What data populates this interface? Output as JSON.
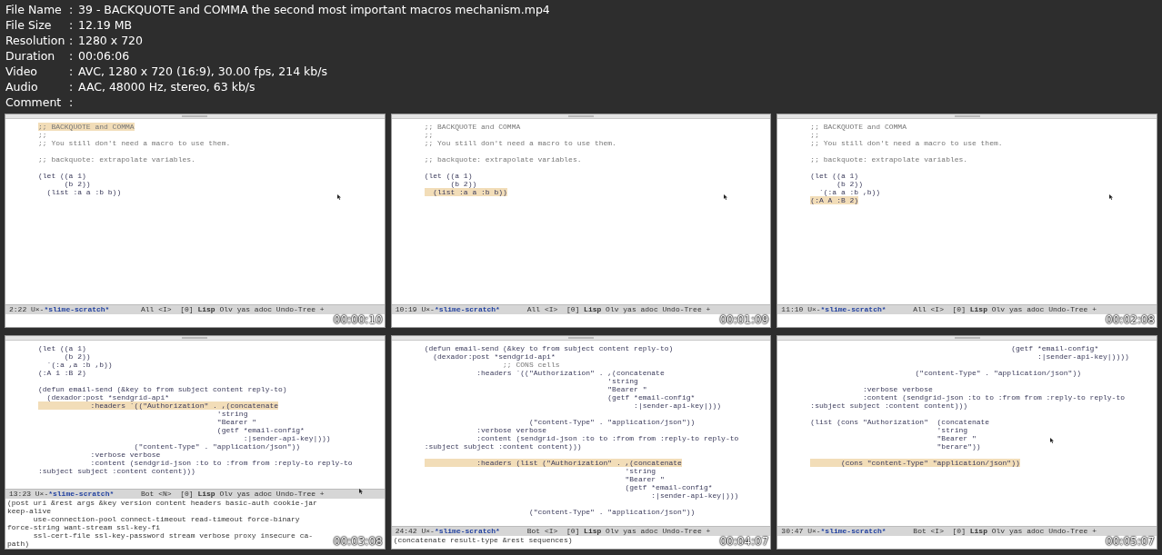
{
  "info": [
    {
      "label": "File Name",
      "sep": ":",
      "value": "39 - BACKQUOTE and COMMA the second most important macros mechanism.mp4"
    },
    {
      "label": "File Size",
      "sep": ":",
      "value": "12.19 MB"
    },
    {
      "label": "Resolution",
      "sep": ":",
      "value": "1280 x 720"
    },
    {
      "label": "Duration",
      "sep": ":",
      "value": "00:06:06"
    },
    {
      "label": "Video",
      "sep": ":",
      "value": "AVC, 1280 x 720 (16:9), 30.00 fps, 214 kb/s"
    },
    {
      "label": "Audio",
      "sep": ":",
      "value": "AAC, 48000 Hz, stereo, 63 kb/s"
    },
    {
      "label": "Comment",
      "sep": ":"
    }
  ],
  "thumbnails": [
    {
      "lines": [
        {
          "kind": "comment",
          "text": ";; BACKQUOTE and COMMA",
          "highlighted": true
        },
        {
          "kind": "comment",
          "text": ";;",
          "highlighted": false
        },
        {
          "kind": "comment",
          "text": ";; You still don't need a macro to use them.",
          "highlighted": false
        },
        {
          "kind": "blank"
        },
        {
          "kind": "comment",
          "text": ";; backquote: extrapolate variables.",
          "highlighted": false
        },
        {
          "kind": "blank"
        },
        {
          "kind": "code",
          "text": "(let ((a 1)",
          "highlighted": false
        },
        {
          "kind": "code",
          "text": "      (b 2))",
          "highlighted": false
        },
        {
          "kind": "code",
          "text": "  (list :a a :b b))",
          "highlighted": false
        }
      ],
      "mode_line": {
        "status": "2:22 U×-",
        "buffer": "*slime-scratch*",
        "modes": "All <I>  [0] **Lisp** Olv yas adoc Undo-Tree +"
      },
      "timestamp": "00:00:10"
    },
    {
      "lines": [
        {
          "kind": "comment",
          "text": ";; BACKQUOTE and COMMA",
          "highlighted": false
        },
        {
          "kind": "comment",
          "text": ";;",
          "highlighted": false
        },
        {
          "kind": "comment",
          "text": ";; You still don't need a macro to use them.",
          "highlighted": false
        },
        {
          "kind": "blank"
        },
        {
          "kind": "comment",
          "text": ";; backquote: extrapolate variables.",
          "highlighted": false
        },
        {
          "kind": "blank"
        },
        {
          "kind": "code",
          "text": "(let ((a 1)",
          "highlighted": false
        },
        {
          "kind": "code",
          "text": "      (b 2))",
          "highlighted": false
        },
        {
          "kind": "code",
          "text": "  (list :a a :b b))",
          "highlighted": true
        }
      ],
      "mode_line": {
        "status": "10:19 U×-",
        "buffer": "*slime-scratch*",
        "modes": "All <I>  [0] **Lisp** Olv yas adoc Undo-Tree +"
      },
      "timestamp": "00:01:09"
    },
    {
      "lines": [
        {
          "kind": "comment",
          "text": ";; BACKQUOTE and COMMA",
          "highlighted": false
        },
        {
          "kind": "comment",
          "text": ";;",
          "highlighted": false
        },
        {
          "kind": "comment",
          "text": ";; You still don't need a macro to use them.",
          "highlighted": false
        },
        {
          "kind": "blank"
        },
        {
          "kind": "comment",
          "text": ";; backquote: extrapolate variables.",
          "highlighted": false
        },
        {
          "kind": "blank"
        },
        {
          "kind": "code",
          "text": "(let ((a 1)",
          "highlighted": false
        },
        {
          "kind": "code",
          "text": "      (b 2))",
          "highlighted": false
        },
        {
          "kind": "code",
          "text": "  `(:a a :b ,b))",
          "highlighted": false
        },
        {
          "kind": "code",
          "text": "(:A A :B 2)",
          "highlighted": true
        }
      ],
      "mode_line": {
        "status": "11:10 U×-",
        "buffer": "*slime-scratch*",
        "modes": "All <I>  [0] **Lisp** Olv yas adoc Undo-Tree +"
      },
      "timestamp": "00:02:08"
    },
    {
      "lines": [
        {
          "kind": "code",
          "text": "(let ((a 1)",
          "highlighted": false
        },
        {
          "kind": "code",
          "text": "      (b 2))",
          "highlighted": false
        },
        {
          "kind": "code",
          "text": "  `(:a ,a :b ,b))",
          "highlighted": false
        },
        {
          "kind": "code",
          "text": "(:A 1 :B 2)",
          "highlighted": false
        },
        {
          "kind": "blank"
        },
        {
          "kind": "code",
          "text": "(defun email-send (&key to from subject content reply-to)",
          "highlighted": false
        },
        {
          "kind": "code",
          "text": "  (dexador:post *sendgrid-api*",
          "highlighted": false
        },
        {
          "kind": "code",
          "text": "            :headers `((\"Authorization\" . ,(concatenate",
          "highlighted": true
        },
        {
          "kind": "code",
          "text": "                                         'string",
          "highlighted": false
        },
        {
          "kind": "code",
          "text": "                                         \"Bearer \"",
          "highlighted": false
        },
        {
          "kind": "code",
          "text": "                                         (getf *email-config*",
          "highlighted": false
        },
        {
          "kind": "code",
          "text": "                                               :|sender-api-key|)))",
          "highlighted": false
        },
        {
          "kind": "code",
          "text": "                      (\"content-Type\" . \"application/json\"))",
          "highlighted": false
        },
        {
          "kind": "code",
          "text": "            :verbose verbose",
          "highlighted": false
        },
        {
          "kind": "code",
          "text": "            :content (sendgrid-json :to to :from from :reply-to reply-to",
          "highlighted": false
        },
        {
          "kind": "code",
          "text": ":subject subject :content content)))",
          "highlighted": false
        }
      ],
      "mode_line": {
        "status": "13:23 U×-",
        "buffer": "*slime-scratch*",
        "modes": "Bot <N>  [0] **Lisp** Olv yas adoc Undo-Tree +"
      },
      "echo": [
        "(post uri &rest args &key version content headers basic-auth cookie-jar keep-alive",
        "      use-connection-pool connect-timeout read-timeout force-binary force-string want-stream ssl-key-fi",
        "      ssl-cert-file ssl-key-password stream verbose proxy insecure ca-path)"
      ],
      "timestamp": "00:03:08"
    },
    {
      "lines": [
        {
          "kind": "code",
          "text": "(defun email-send (&key to from subject content reply-to)",
          "highlighted": false
        },
        {
          "kind": "code",
          "text": "  (dexador:post *sendgrid-api*",
          "highlighted": false
        },
        {
          "kind": "comment",
          "text": "                  ;; CONS cells",
          "highlighted": false
        },
        {
          "kind": "code",
          "text": "            :headers `((\"Authorization\" . ,(concatenate",
          "highlighted": false
        },
        {
          "kind": "code",
          "text": "                                          'string",
          "highlighted": false
        },
        {
          "kind": "code",
          "text": "                                          \"Bearer \"",
          "highlighted": false
        },
        {
          "kind": "code",
          "text": "                                          (getf *email-config*",
          "highlighted": false
        },
        {
          "kind": "code",
          "text": "                                                :|sender-api-key|)))",
          "highlighted": false
        },
        {
          "kind": "blank"
        },
        {
          "kind": "code",
          "text": "                        (\"content-Type\" . \"application/json\"))",
          "highlighted": false
        },
        {
          "kind": "code",
          "text": "            :verbose verbose",
          "highlighted": false
        },
        {
          "kind": "code",
          "text": "            :content (sendgrid-json :to to :from from :reply-to reply-to",
          "highlighted": false
        },
        {
          "kind": "code",
          "text": ":subject subject :content content)))",
          "highlighted": false
        },
        {
          "kind": "blank"
        },
        {
          "kind": "code",
          "text": "            :headers (list (\"Authorization\" . ,(concatenate",
          "highlighted": true
        },
        {
          "kind": "code",
          "text": "                                              'string",
          "highlighted": false
        },
        {
          "kind": "code",
          "text": "                                              \"Bearer \"",
          "highlighted": false
        },
        {
          "kind": "code",
          "text": "                                              (getf *email-config*",
          "highlighted": false
        },
        {
          "kind": "code",
          "text": "                                                    :|sender-api-key|)))",
          "highlighted": false
        },
        {
          "kind": "blank"
        },
        {
          "kind": "code",
          "text": "                        (\"content-Type\" . \"application/json\"))",
          "highlighted": false
        }
      ],
      "mode_line": {
        "status": "24:42 U×-",
        "buffer": "*slime-scratch*",
        "modes": "Bot <I>  [0] **Lisp** Olv yas adoc Undo-Tree +"
      },
      "echo": [
        "(concatenate result-type &rest sequences)"
      ],
      "timestamp": "00:04:07"
    },
    {
      "lines": [
        {
          "kind": "code",
          "text": "                                              (getf *email-config*",
          "highlighted": false
        },
        {
          "kind": "code",
          "text": "                                                    :|sender-api-key|))))",
          "highlighted": false
        },
        {
          "kind": "blank"
        },
        {
          "kind": "code",
          "text": "                        (\"content-Type\" . \"application/json\"))",
          "highlighted": false
        },
        {
          "kind": "blank"
        },
        {
          "kind": "code",
          "text": "            :verbose verbose",
          "highlighted": false
        },
        {
          "kind": "code",
          "text": "            :content (sendgrid-json :to to :from from :reply-to reply-to",
          "highlighted": false
        },
        {
          "kind": "code",
          "text": ":subject subject :content content)))",
          "highlighted": false
        },
        {
          "kind": "blank"
        },
        {
          "kind": "code",
          "text": "(list (cons \"Authorization\"  (concatenate",
          "highlighted": false
        },
        {
          "kind": "code",
          "text": "                             'string",
          "highlighted": false
        },
        {
          "kind": "code",
          "text": "                             \"Bearer \"",
          "highlighted": false
        },
        {
          "kind": "code",
          "text": "                             \"berare\"))",
          "highlighted": false
        },
        {
          "kind": "blank"
        },
        {
          "kind": "code",
          "text": "       (cons \"content-Type\" \"application/json\"))",
          "highlighted": true
        }
      ],
      "mode_line": {
        "status": "30:47 U×-",
        "buffer": "*slime-scratch*",
        "modes": "Bot <I>  [0] **Lisp** Olv yas adoc Undo-Tree +"
      },
      "timestamp": "00:05:07"
    }
  ]
}
